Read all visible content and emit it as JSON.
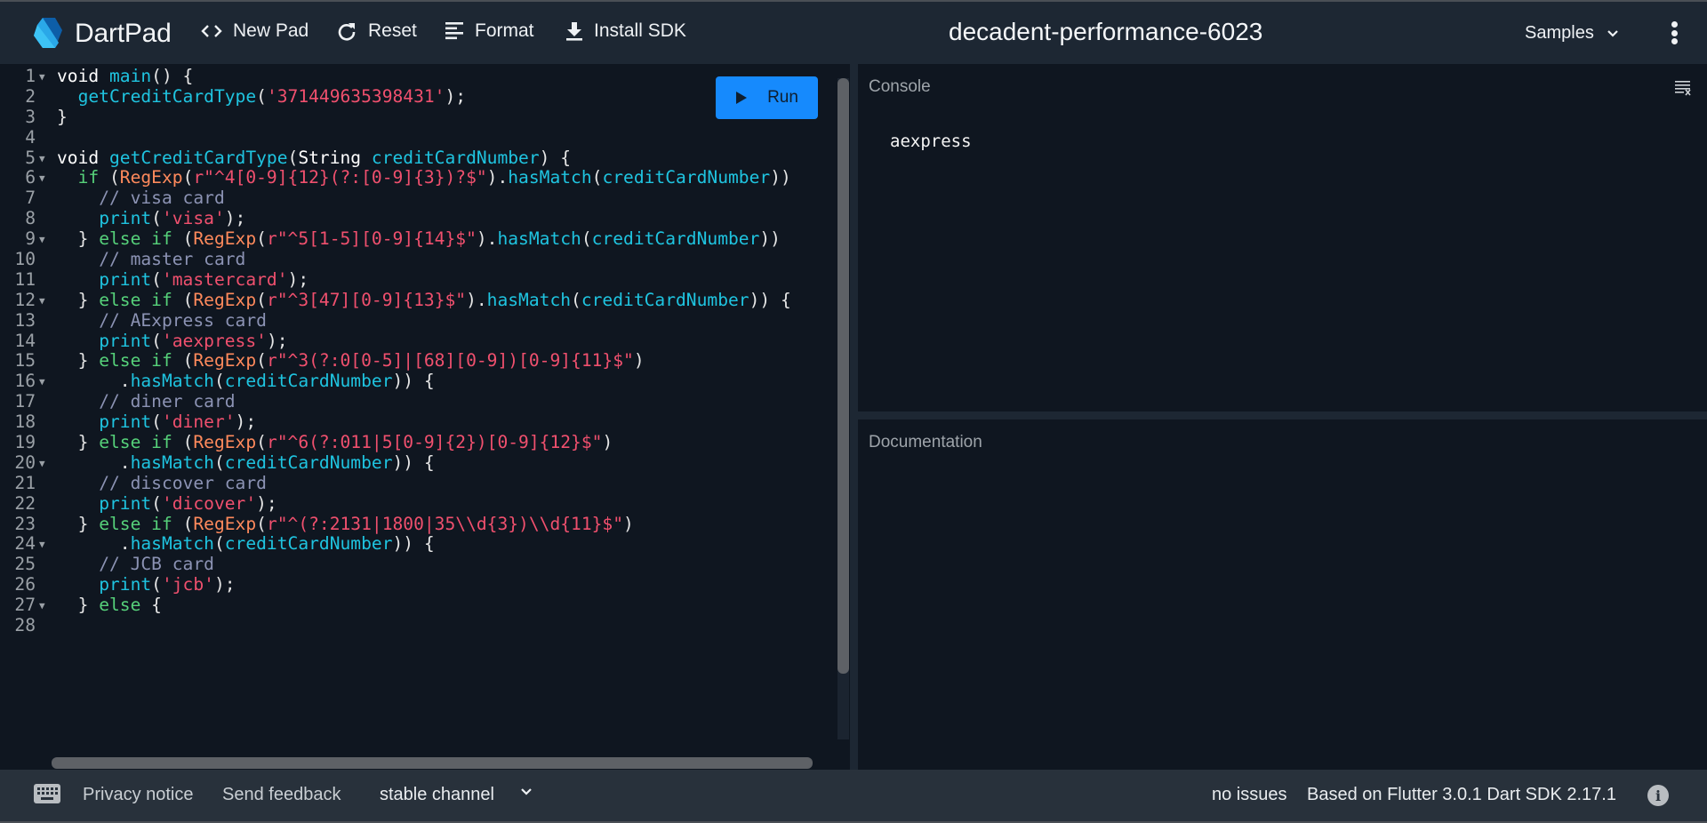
{
  "header": {
    "app_name": "DartPad",
    "buttons": [
      {
        "label": "New Pad",
        "icon": "code-brackets-icon"
      },
      {
        "label": "Reset",
        "icon": "refresh-icon"
      },
      {
        "label": "Format",
        "icon": "format-align-icon"
      },
      {
        "label": "Install SDK",
        "icon": "download-icon"
      }
    ],
    "pad_title": "decadent-performance-6023",
    "samples_label": "Samples"
  },
  "editor": {
    "run_label": "Run",
    "lines": [
      {
        "n": "1",
        "fold": true
      },
      {
        "n": "2",
        "fold": false
      },
      {
        "n": "3",
        "fold": false
      },
      {
        "n": "4",
        "fold": false
      },
      {
        "n": "5",
        "fold": true
      },
      {
        "n": "6",
        "fold": true
      },
      {
        "n": "7",
        "fold": false
      },
      {
        "n": "8",
        "fold": false
      },
      {
        "n": "9",
        "fold": true
      },
      {
        "n": "10",
        "fold": false
      },
      {
        "n": "11",
        "fold": false
      },
      {
        "n": "12",
        "fold": true
      },
      {
        "n": "13",
        "fold": false
      },
      {
        "n": "14",
        "fold": false
      },
      {
        "n": "15",
        "fold": false
      },
      {
        "n": "16",
        "fold": true
      },
      {
        "n": "17",
        "fold": false
      },
      {
        "n": "18",
        "fold": false
      },
      {
        "n": "19",
        "fold": false
      },
      {
        "n": "20",
        "fold": true
      },
      {
        "n": "21",
        "fold": false
      },
      {
        "n": "22",
        "fold": false
      },
      {
        "n": "23",
        "fold": false
      },
      {
        "n": "24",
        "fold": true
      },
      {
        "n": "25",
        "fold": false
      },
      {
        "n": "26",
        "fold": false
      },
      {
        "n": "27",
        "fold": true
      },
      {
        "n": "28",
        "fold": false
      }
    ],
    "tokens": [
      [
        [
          "k",
          "void "
        ],
        [
          "fn",
          "main"
        ],
        [
          "p",
          "() {"
        ]
      ],
      [
        [
          "p",
          "  "
        ],
        [
          "fn",
          "getCreditCardType"
        ],
        [
          "p",
          "("
        ],
        [
          "str",
          "'371449635398431'"
        ],
        [
          "p",
          ");"
        ]
      ],
      [
        [
          "p",
          "}"
        ]
      ],
      [],
      [
        [
          "k",
          "void "
        ],
        [
          "fn",
          "getCreditCardType"
        ],
        [
          "p",
          "("
        ],
        [
          "k",
          "String "
        ],
        [
          "fn",
          "creditCardNumber"
        ],
        [
          "p",
          ") {"
        ]
      ],
      [
        [
          "p",
          "  "
        ],
        [
          "kw",
          "if "
        ],
        [
          "p",
          "("
        ],
        [
          "cls",
          "RegExp"
        ],
        [
          "p",
          "("
        ],
        [
          "str",
          "r\"^4[0-9]{12}(?:[0-9]{3})?$\""
        ],
        [
          "p",
          ")."
        ],
        [
          "fn",
          "hasMatch"
        ],
        [
          "p",
          "("
        ],
        [
          "fn",
          "creditCardNumber"
        ],
        [
          "p",
          "))"
        ]
      ],
      [
        [
          "p",
          "    "
        ],
        [
          "cm",
          "// visa card"
        ]
      ],
      [
        [
          "p",
          "    "
        ],
        [
          "fn",
          "print"
        ],
        [
          "p",
          "("
        ],
        [
          "str",
          "'visa'"
        ],
        [
          "p",
          ");"
        ]
      ],
      [
        [
          "p",
          "  } "
        ],
        [
          "kw",
          "else if "
        ],
        [
          "p",
          "("
        ],
        [
          "cls",
          "RegExp"
        ],
        [
          "p",
          "("
        ],
        [
          "str",
          "r\"^5[1-5][0-9]{14}$\""
        ],
        [
          "p",
          ")."
        ],
        [
          "fn",
          "hasMatch"
        ],
        [
          "p",
          "("
        ],
        [
          "fn",
          "creditCardNumber"
        ],
        [
          "p",
          "))"
        ]
      ],
      [
        [
          "p",
          "    "
        ],
        [
          "cm",
          "// master card"
        ]
      ],
      [
        [
          "p",
          "    "
        ],
        [
          "fn",
          "print"
        ],
        [
          "p",
          "("
        ],
        [
          "str",
          "'mastercard'"
        ],
        [
          "p",
          ");"
        ]
      ],
      [
        [
          "p",
          "  } "
        ],
        [
          "kw",
          "else if "
        ],
        [
          "p",
          "("
        ],
        [
          "cls",
          "RegExp"
        ],
        [
          "p",
          "("
        ],
        [
          "str",
          "r\"^3[47][0-9]{13}$\""
        ],
        [
          "p",
          ")."
        ],
        [
          "fn",
          "hasMatch"
        ],
        [
          "p",
          "("
        ],
        [
          "fn",
          "creditCardNumber"
        ],
        [
          "p",
          ")) {"
        ]
      ],
      [
        [
          "p",
          "    "
        ],
        [
          "cm",
          "// AExpress card"
        ]
      ],
      [
        [
          "p",
          "    "
        ],
        [
          "fn",
          "print"
        ],
        [
          "p",
          "("
        ],
        [
          "str",
          "'aexpress'"
        ],
        [
          "p",
          ");"
        ]
      ],
      [
        [
          "p",
          "  } "
        ],
        [
          "kw",
          "else if "
        ],
        [
          "p",
          "("
        ],
        [
          "cls",
          "RegExp"
        ],
        [
          "p",
          "("
        ],
        [
          "str",
          "r\"^3(?:0[0-5]|[68][0-9])[0-9]{11}$\""
        ],
        [
          "p",
          ")"
        ]
      ],
      [
        [
          "p",
          "      ."
        ],
        [
          "fn",
          "hasMatch"
        ],
        [
          "p",
          "("
        ],
        [
          "fn",
          "creditCardNumber"
        ],
        [
          "p",
          ")) {"
        ]
      ],
      [
        [
          "p",
          "    "
        ],
        [
          "cm",
          "// diner card"
        ]
      ],
      [
        [
          "p",
          "    "
        ],
        [
          "fn",
          "print"
        ],
        [
          "p",
          "("
        ],
        [
          "str",
          "'diner'"
        ],
        [
          "p",
          ");"
        ]
      ],
      [
        [
          "p",
          "  } "
        ],
        [
          "kw",
          "else if "
        ],
        [
          "p",
          "("
        ],
        [
          "cls",
          "RegExp"
        ],
        [
          "p",
          "("
        ],
        [
          "str",
          "r\"^6(?:011|5[0-9]{2})[0-9]{12}$\""
        ],
        [
          "p",
          ")"
        ]
      ],
      [
        [
          "p",
          "      ."
        ],
        [
          "fn",
          "hasMatch"
        ],
        [
          "p",
          "("
        ],
        [
          "fn",
          "creditCardNumber"
        ],
        [
          "p",
          ")) {"
        ]
      ],
      [
        [
          "p",
          "    "
        ],
        [
          "cm",
          "// discover card"
        ]
      ],
      [
        [
          "p",
          "    "
        ],
        [
          "fn",
          "print"
        ],
        [
          "p",
          "("
        ],
        [
          "str",
          "'dicover'"
        ],
        [
          "p",
          ");"
        ]
      ],
      [
        [
          "p",
          "  } "
        ],
        [
          "kw",
          "else if "
        ],
        [
          "p",
          "("
        ],
        [
          "cls",
          "RegExp"
        ],
        [
          "p",
          "("
        ],
        [
          "str",
          "r\"^(?:2131|1800|35\\\\d{3})\\\\d{11}$\""
        ],
        [
          "p",
          ")"
        ]
      ],
      [
        [
          "p",
          "      ."
        ],
        [
          "fn",
          "hasMatch"
        ],
        [
          "p",
          "("
        ],
        [
          "fn",
          "creditCardNumber"
        ],
        [
          "p",
          ")) {"
        ]
      ],
      [
        [
          "p",
          "    "
        ],
        [
          "cm",
          "// JCB card"
        ]
      ],
      [
        [
          "p",
          "    "
        ],
        [
          "fn",
          "print"
        ],
        [
          "p",
          "("
        ],
        [
          "str",
          "'jcb'"
        ],
        [
          "p",
          ");"
        ]
      ],
      [
        [
          "p",
          "  } "
        ],
        [
          "kw",
          "else "
        ],
        [
          "p",
          "{"
        ]
      ],
      []
    ]
  },
  "console": {
    "title": "Console",
    "output": "aexpress"
  },
  "documentation": {
    "title": "Documentation"
  },
  "footer": {
    "privacy": "Privacy notice",
    "feedback": "Send feedback",
    "channel": "stable channel",
    "issues": "no issues",
    "version": "Based on Flutter 3.0.1 Dart SDK 2.17.1"
  },
  "colors": {
    "run_button": "#168afd",
    "header_bg": "#1d2733",
    "editor_bg": "#0f1620",
    "footer_bg": "#28313b"
  }
}
